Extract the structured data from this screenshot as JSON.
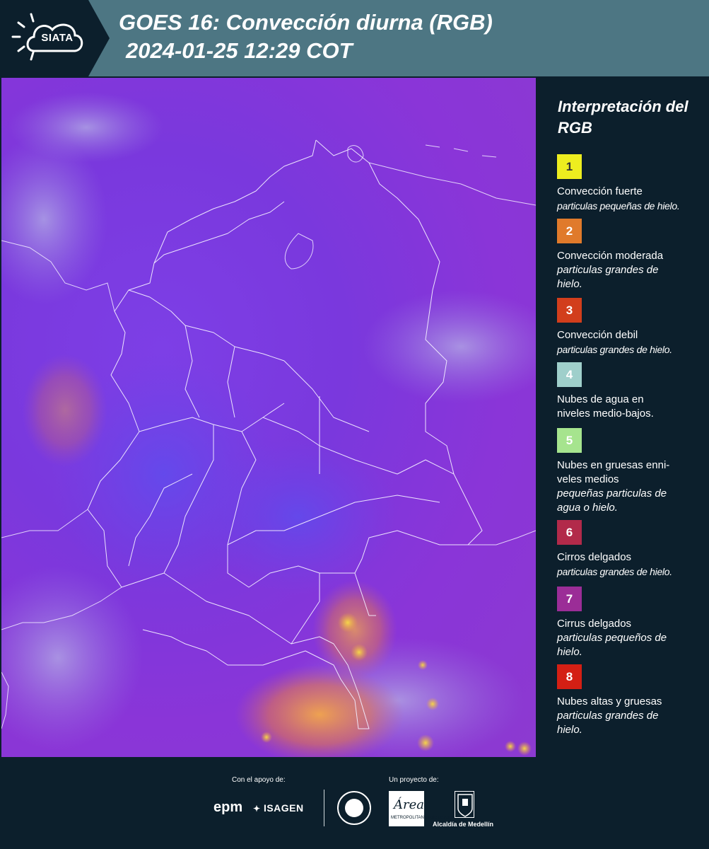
{
  "header": {
    "logo_text": "SIATA",
    "title_line1": "GOES 16: Convección diurna (RGB)",
    "title_line2": "2024-01-25 12:29 COT"
  },
  "legend": {
    "title": "Interpretación del RGB",
    "items": [
      {
        "number": "1",
        "color": "#eded1f",
        "text_color": "#333333",
        "label": "Convección fuerte",
        "desc": "particulas pequeñas de hielo."
      },
      {
        "number": "2",
        "color": "#e07a2b",
        "text_color": "#ffffff",
        "label": "Convección moderada",
        "desc": "particulas grandes de hielo."
      },
      {
        "number": "3",
        "color": "#d23e1c",
        "text_color": "#ffffff",
        "label": "Convección debil",
        "desc": "particulas grandes de hielo."
      },
      {
        "number": "4",
        "color": "#9fcfcb",
        "text_color": "#ffffff",
        "label": "Nubes de agua en niveles medio-bajos.",
        "desc": ""
      },
      {
        "number": "5",
        "color": "#a6e48e",
        "text_color": "#ffffff",
        "label": "Nubes en gruesas enni-veles medios",
        "desc": "pequeñas particulas de agua o hielo."
      },
      {
        "number": "6",
        "color": "#b22a4a",
        "text_color": "#ffffff",
        "label": "Cirros delgados",
        "desc": "particulas grandes de hielo."
      },
      {
        "number": "7",
        "color": "#9b2d97",
        "text_color": "#ffffff",
        "label": "Cirrus delgados",
        "desc": "particulas pequeños de hielo."
      },
      {
        "number": "8",
        "color": "#d41f14",
        "text_color": "#ffffff",
        "label": "Nubes altas y gruesas",
        "desc": "particulas grandes de hielo."
      }
    ]
  },
  "footer": {
    "support_label": "Con el apoyo de:",
    "project_label": "Un proyecto de:",
    "epm": "epm",
    "isagen": "ISAGEN",
    "area_word": "Área",
    "area_sub": "METROPOLITANA Valle de Aburrá",
    "alcaldia": "Alcaldía de Medellín"
  }
}
